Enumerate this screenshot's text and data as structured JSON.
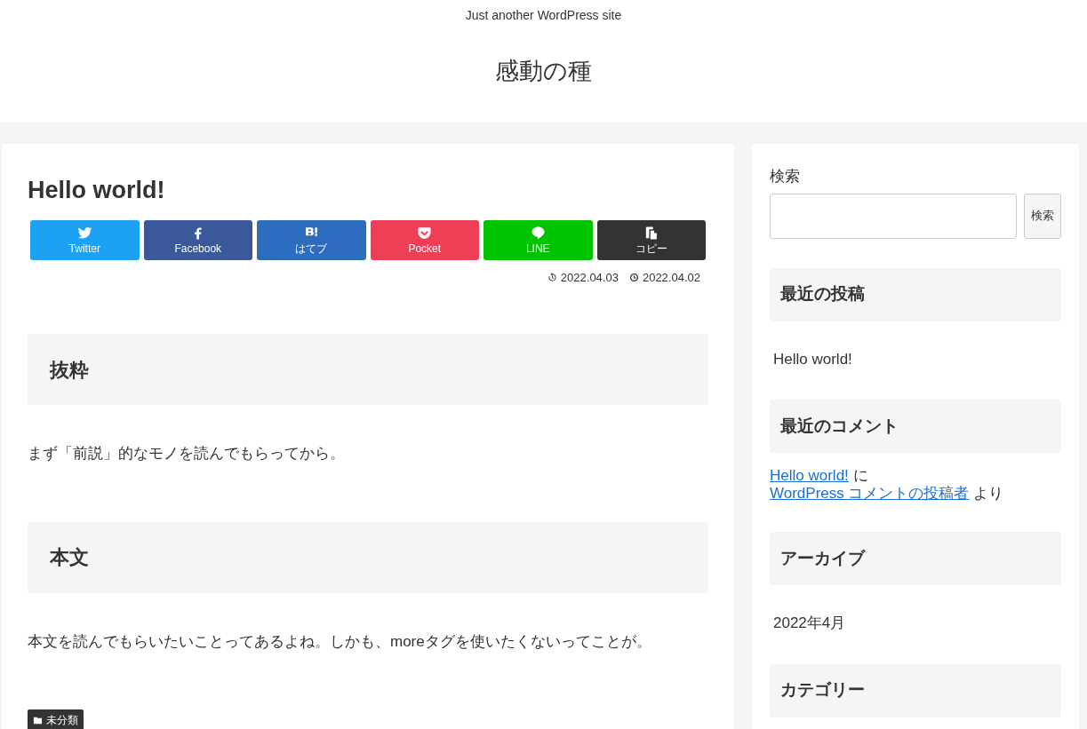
{
  "header": {
    "tagline": "Just another WordPress site",
    "site_title": "感動の種"
  },
  "article": {
    "title": "Hello world!",
    "share_buttons": [
      {
        "kind": "twitter",
        "label": "Twitter",
        "color": "#1da1f2"
      },
      {
        "kind": "facebook",
        "label": "Facebook",
        "color": "#3b5998"
      },
      {
        "kind": "hatena",
        "label": "はてブ",
        "color": "#2c6ebd"
      },
      {
        "kind": "pocket",
        "label": "Pocket",
        "color": "#ef3f56"
      },
      {
        "kind": "line",
        "label": "LINE",
        "color": "#00c300"
      },
      {
        "kind": "copy",
        "label": "コピー",
        "color": "#333333"
      }
    ],
    "dates": [
      {
        "kind": "updated",
        "text": "2022.04.03"
      },
      {
        "kind": "published",
        "text": "2022.04.02"
      }
    ],
    "content": [
      {
        "kind": "heading",
        "text": "抜粋"
      },
      {
        "kind": "paragraph",
        "text": "まず「前説」的なモノを読んでもらってから。"
      },
      {
        "kind": "heading",
        "text": "本文"
      },
      {
        "kind": "paragraph",
        "text": "本文を読んでもらいたいことってあるよね。しかも、moreタグを使いたくないってことが。"
      }
    ],
    "category": "未分類"
  },
  "sidebar": {
    "search": {
      "label": "検索",
      "button": "検索"
    },
    "widgets": [
      {
        "title": "最近の投稿",
        "items": [
          [
            {
              "kind": "text",
              "text": "Hello world!"
            }
          ]
        ]
      },
      {
        "title": "最近のコメント",
        "items": [
          [
            {
              "kind": "link",
              "text": "Hello world!"
            },
            {
              "kind": "text",
              "text": "に"
            },
            {
              "kind": "link",
              "text": "WordPress コメントの投稿者"
            },
            {
              "kind": "text",
              "text": "より"
            }
          ]
        ]
      },
      {
        "title": "アーカイブ",
        "items": [
          [
            {
              "kind": "text",
              "text": "2022年4月"
            }
          ]
        ]
      },
      {
        "title": "カテゴリー"
      }
    ]
  }
}
